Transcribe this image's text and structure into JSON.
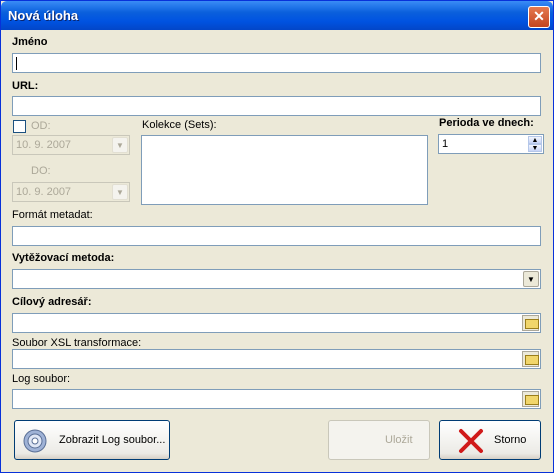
{
  "window": {
    "title": "Nová úloha",
    "close_glyph": "✕"
  },
  "name": {
    "label": "Jméno",
    "value": ""
  },
  "url": {
    "label": "URL:",
    "value": ""
  },
  "od": {
    "label": "OD:",
    "date": "10. 9. 2007",
    "checked": false
  },
  "do": {
    "label": "DO:",
    "date": "10. 9. 2007"
  },
  "sets": {
    "label": "Kolekce (Sets):"
  },
  "period": {
    "label": "Perioda ve dnech:",
    "value": "1"
  },
  "metadata_format": {
    "label": "Formát metadat:",
    "value": ""
  },
  "harvest_method": {
    "label": "Vytěžovací metoda:",
    "value": ""
  },
  "target_dir": {
    "label": "Cílový adresář:",
    "value": ""
  },
  "xsl_file": {
    "label": "Soubor XSL transformace:",
    "value": ""
  },
  "log_file": {
    "label": "Log soubor:",
    "value": ""
  },
  "buttons": {
    "show_log": "Zobrazit Log soubor...",
    "save": "Uložit",
    "cancel": "Storno"
  },
  "icons": {
    "gear": "gear-icon",
    "cancel": "red-x-icon",
    "folder": "folder-icon",
    "folder_open": "open-folder-icon"
  },
  "colors": {
    "title_bar": "#0a5fdc",
    "window_bg": "#ece9d8",
    "field_border": "#7f9db9",
    "cancel_x": "#d01a1a"
  }
}
